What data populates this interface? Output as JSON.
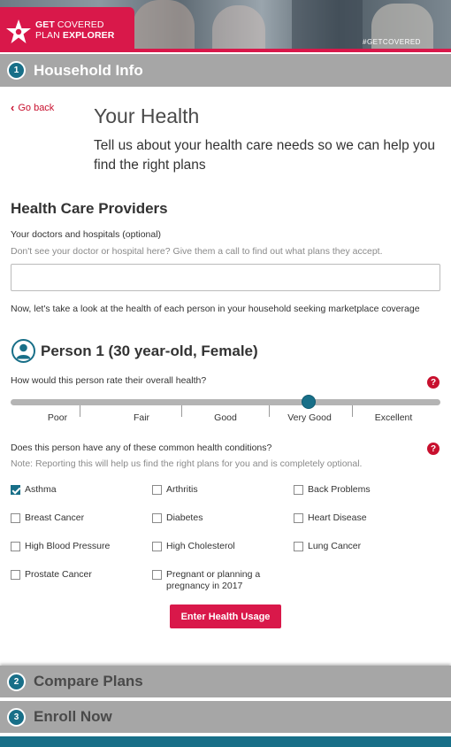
{
  "banner": {
    "logo_line1_bold": "GET",
    "logo_line1_rest": " COVERED",
    "logo_line2_rest": "PLAN ",
    "logo_line2_bold": "EXPLORER",
    "hashtag": "#GETCOVERED",
    "brand_color": "#d9184a"
  },
  "steps": [
    {
      "number": "1",
      "label": "Household Info"
    },
    {
      "number": "2",
      "label": "Compare Plans"
    },
    {
      "number": "3",
      "label": "Enroll Now"
    }
  ],
  "nav": {
    "go_back": "Go back"
  },
  "page": {
    "title": "Your Health",
    "subtitle": "Tell us about your health care needs so we can help you find the right plans"
  },
  "providers": {
    "heading": "Health Care Providers",
    "field_label": "Your doctors and hospitals (optional)",
    "help_text": "Don't see your doctor or hospital here? Give them a call to find out what plans they accept.",
    "value": ""
  },
  "intro": "Now, let's take a look at the health of each person in your household seeking marketplace coverage",
  "person": {
    "title": "Person 1 (30 year-old, Female)",
    "health_question": "How would this person rate their overall health?",
    "health_scale": [
      "Poor",
      "Fair",
      "Good",
      "Very Good",
      "Excellent"
    ],
    "health_selected": "Very Good",
    "conditions_question": "Does this person have any of these common health conditions?",
    "conditions_note": "Note: Reporting this will help us find the right plans for you and is completely optional.",
    "conditions": [
      {
        "label": "Asthma",
        "checked": true
      },
      {
        "label": "Arthritis",
        "checked": false
      },
      {
        "label": "Back Problems",
        "checked": false
      },
      {
        "label": "Breast Cancer",
        "checked": false
      },
      {
        "label": "Diabetes",
        "checked": false
      },
      {
        "label": "Heart Disease",
        "checked": false
      },
      {
        "label": "High Blood Pressure",
        "checked": false
      },
      {
        "label": "High Cholesterol",
        "checked": false
      },
      {
        "label": "Lung Cancer",
        "checked": false
      },
      {
        "label": "Prostate Cancer",
        "checked": false
      },
      {
        "label": "Pregnant or planning a pregnancy in 2017",
        "checked": false
      }
    ]
  },
  "help_icon_glyph": "?",
  "cta_label": "Enter Health Usage",
  "colors": {
    "accent": "#d9184a",
    "teal": "#186f88",
    "step_bar": "#a6a6a6"
  }
}
